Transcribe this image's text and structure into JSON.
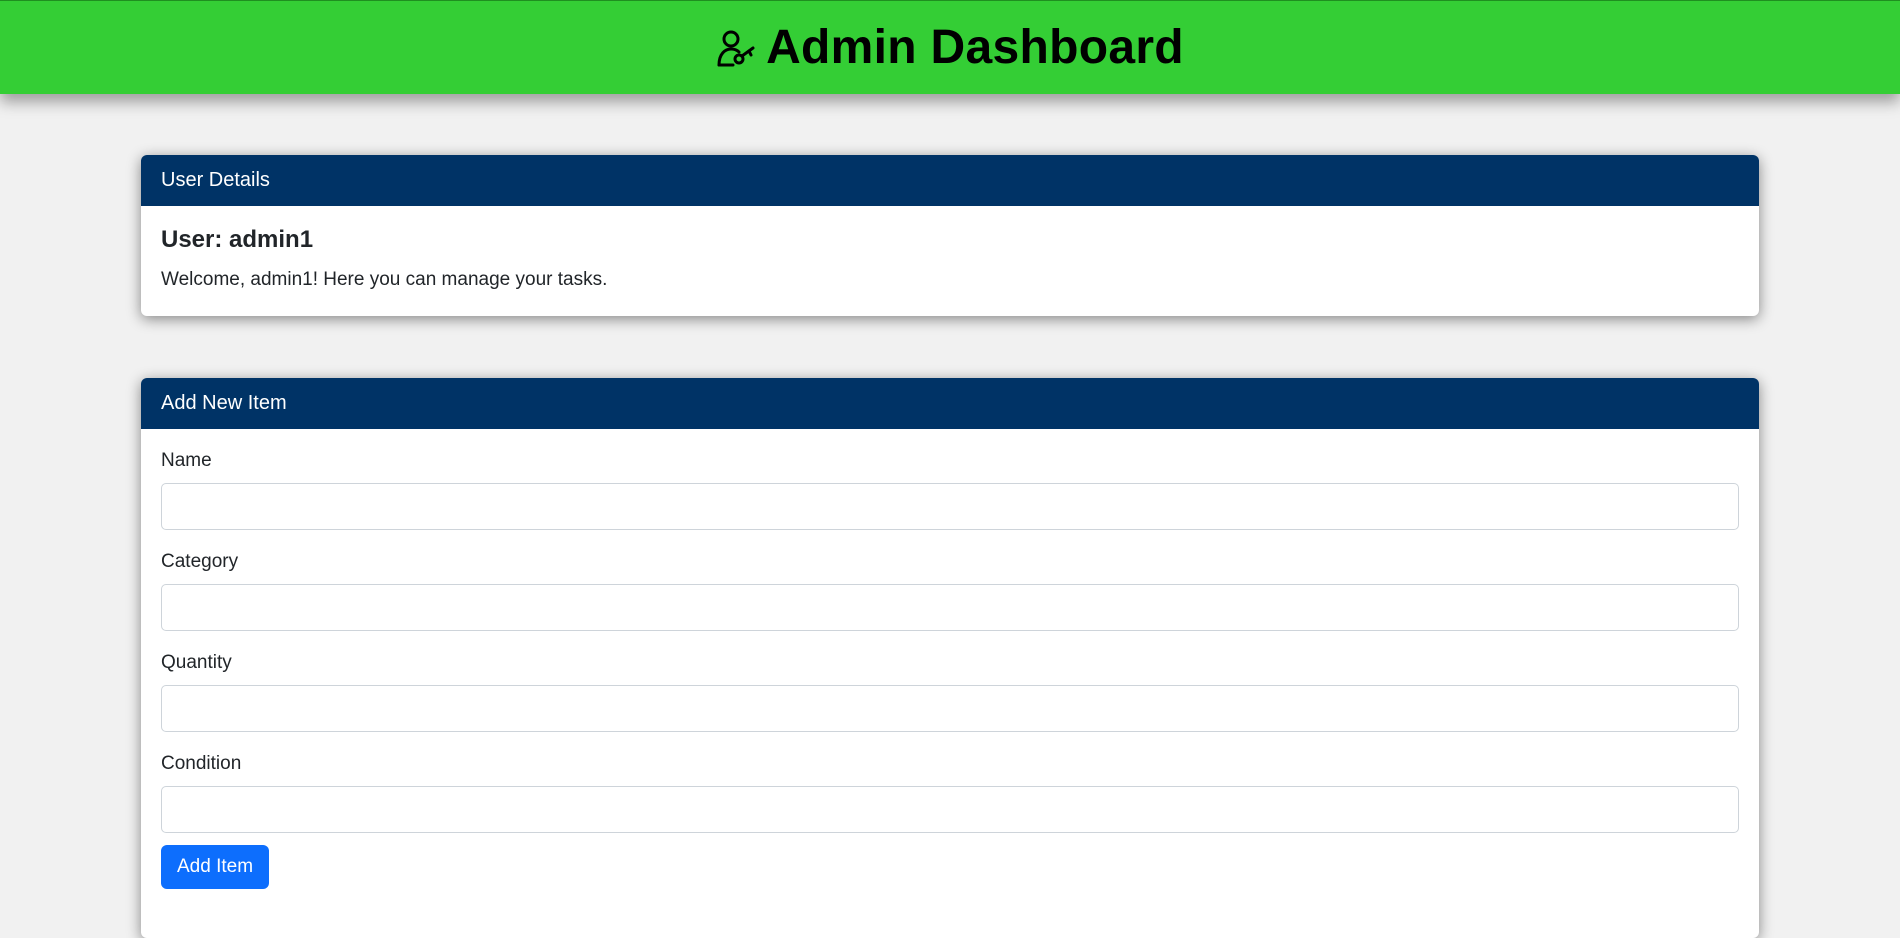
{
  "header": {
    "title": "Admin Dashboard",
    "icon": "user-key-icon",
    "background_color": "#34ce35"
  },
  "user_details": {
    "header": "User Details",
    "user_label": "User: admin1",
    "welcome": "Welcome, admin1! Here you can manage your tasks."
  },
  "add_item": {
    "header": "Add New Item",
    "fields": [
      {
        "label": "Name",
        "value": ""
      },
      {
        "label": "Category",
        "value": ""
      },
      {
        "label": "Quantity",
        "value": ""
      },
      {
        "label": "Condition",
        "value": ""
      }
    ],
    "submit_label": "Add Item"
  },
  "colors": {
    "card_header": "#003366",
    "primary_button": "#0d6efd"
  }
}
